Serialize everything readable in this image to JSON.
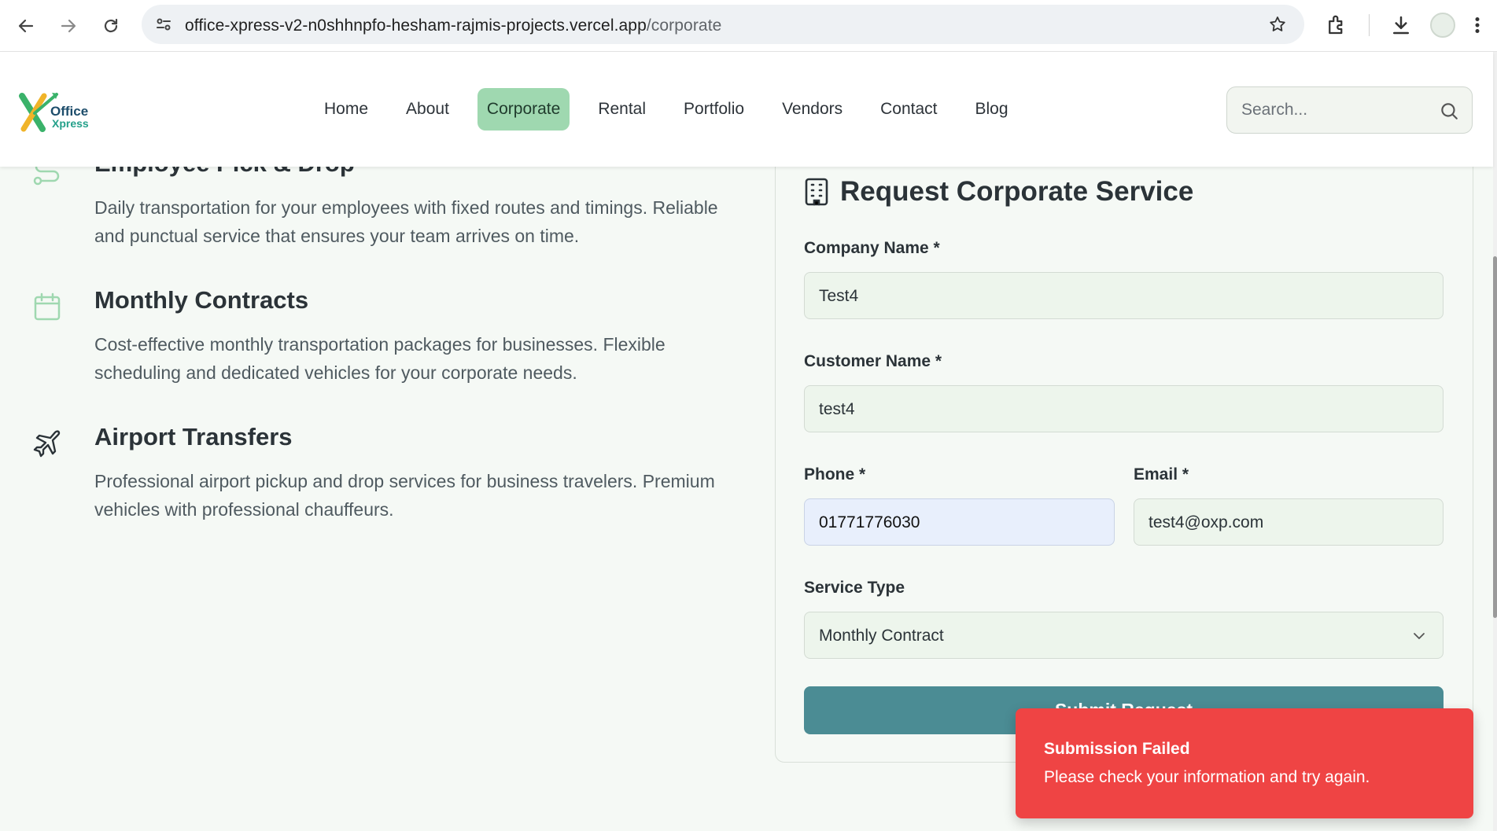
{
  "browser": {
    "url_host": "office-xpress-v2-n0shhnpfo-hesham-rajmis-projects.vercel.app",
    "url_path": "/corporate"
  },
  "header": {
    "logo_text_top": "Office",
    "logo_text_bottom": "Xpress",
    "nav": [
      "Home",
      "About",
      "Corporate",
      "Rental",
      "Portfolio",
      "Vendors",
      "Contact",
      "Blog"
    ],
    "active_nav": "Corporate",
    "search_placeholder": "Search..."
  },
  "services": [
    {
      "title": "Employee Pick & Drop",
      "icon": "route-icon",
      "description": "Daily transportation for your employees with fixed routes and timings. Reliable and punctual service that ensures your team arrives on time."
    },
    {
      "title": "Monthly Contracts",
      "icon": "calendar-icon",
      "description": "Cost-effective monthly transportation packages for businesses. Flexible scheduling and dedicated vehicles for your corporate needs."
    },
    {
      "title": "Airport Transfers",
      "icon": "plane-icon",
      "description": "Professional airport pickup and drop services for business travelers. Premium vehicles with professional chauffeurs."
    }
  ],
  "form": {
    "title": "Request Corporate Service",
    "company_label": "Company Name *",
    "company_value": "Test4",
    "customer_label": "Customer Name *",
    "customer_value": "test4",
    "phone_label": "Phone *",
    "phone_value": "01771776030",
    "email_label": "Email *",
    "email_value": "test4@oxp.com",
    "service_label": "Service Type",
    "service_value": "Monthly Contract",
    "submit_label": "Submit Request"
  },
  "toast": {
    "title": "Submission Failed",
    "message": "Please check your information and try again."
  },
  "colors": {
    "accent": "#4b8c94",
    "nav_active": "#9fd8b0",
    "error": "#ef4444"
  }
}
